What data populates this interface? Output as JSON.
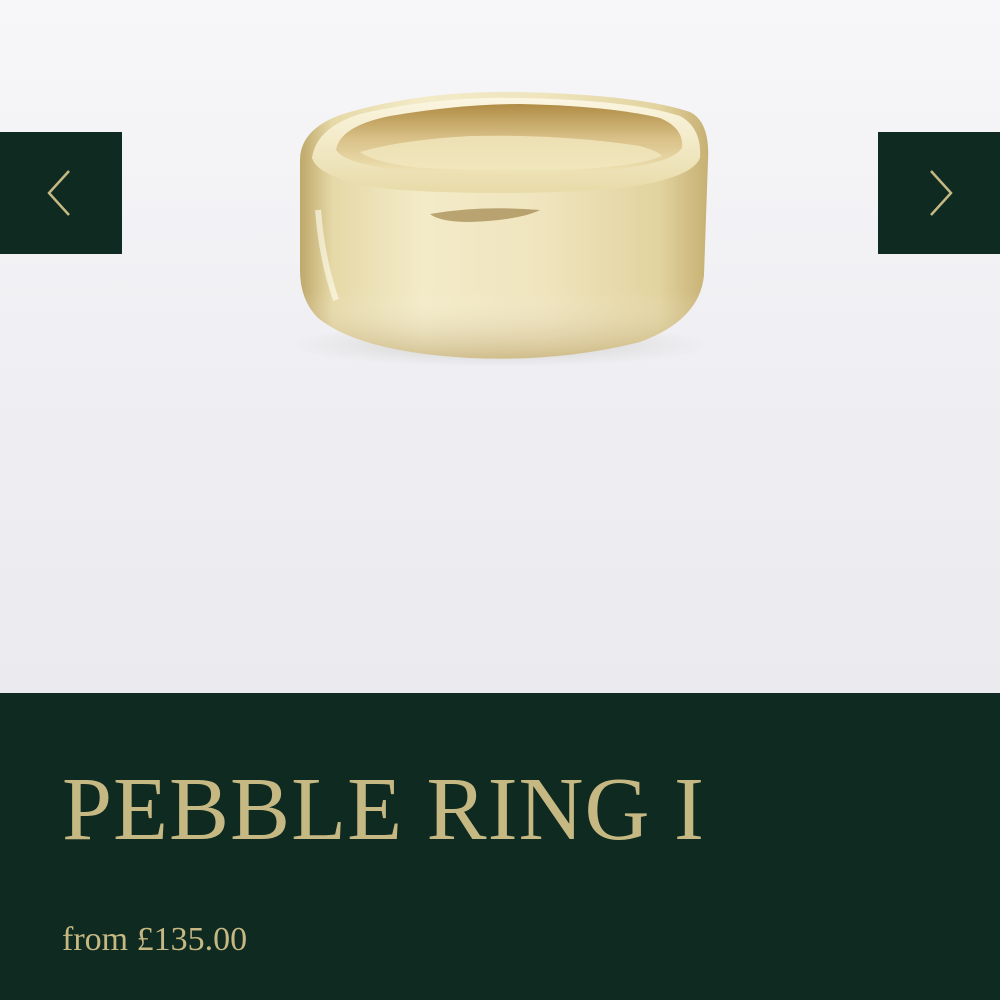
{
  "product": {
    "title": "PEBBLE RING I",
    "price": "from £135.00"
  },
  "gallery": {
    "prev_icon": "chevron-left-icon",
    "next_icon": "chevron-right-icon"
  },
  "colors": {
    "brand_green": "#0f2a20",
    "gold_text": "#c6b882",
    "image_background": "#f2f2f5"
  }
}
